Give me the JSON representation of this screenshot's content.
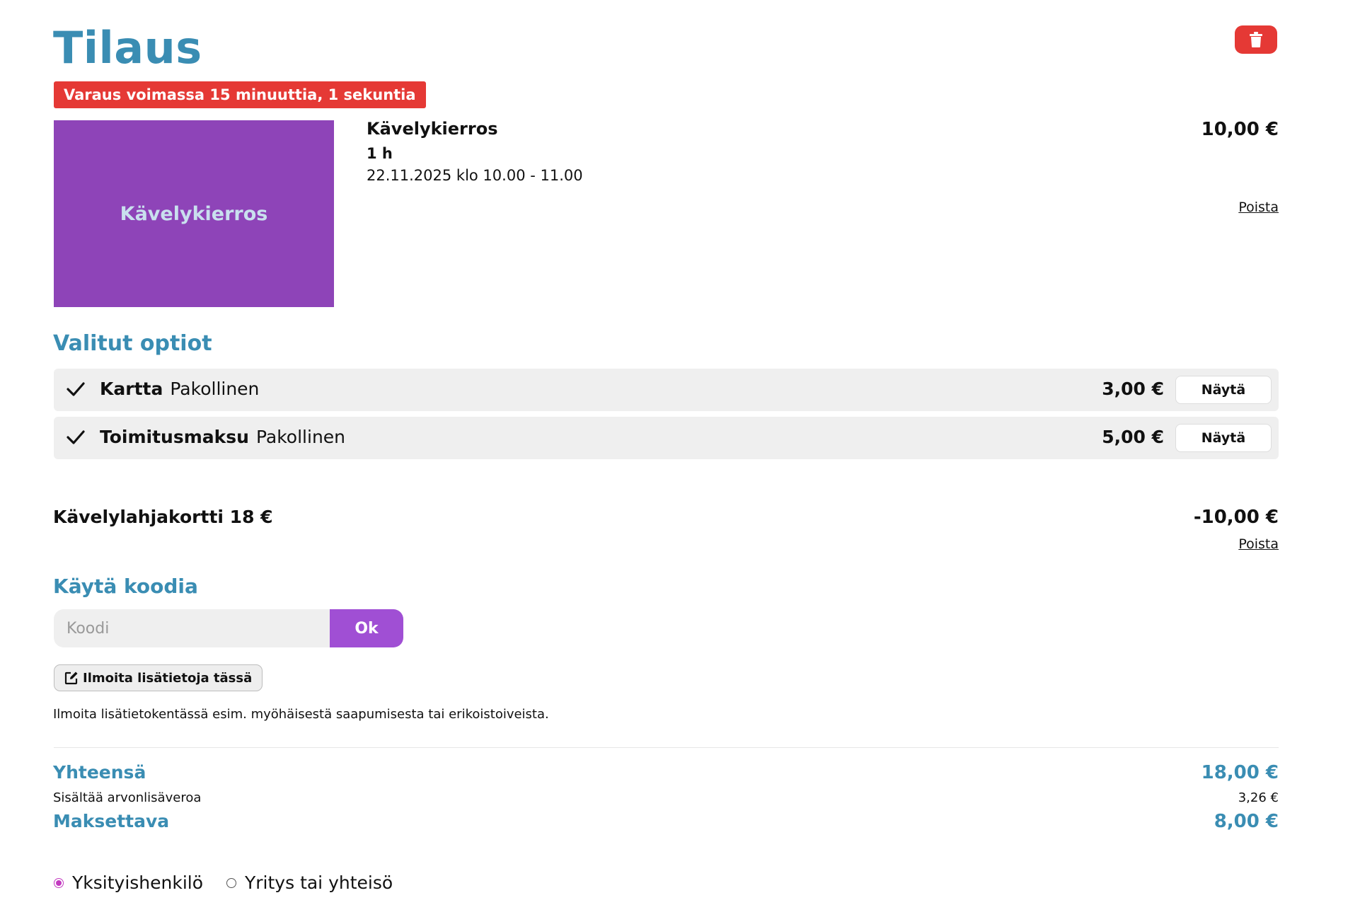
{
  "page": {
    "title": "Tilaus"
  },
  "reservation": {
    "timer_text": "Varaus voimassa 15 minuuttia, 1 sekuntia"
  },
  "product": {
    "image_label": "Kävelykierros",
    "name": "Kävelykierros",
    "duration": "1 h",
    "date": "22.11.2025 klo 10.00 - 11.00",
    "price": "10,00 €",
    "remove_label": "Poista"
  },
  "options": {
    "title": "Valitut optiot",
    "items": [
      {
        "name": "Kartta",
        "tag": "Pakollinen",
        "price": "3,00 €",
        "button": "Näytä"
      },
      {
        "name": "Toimitusmaksu",
        "tag": "Pakollinen",
        "price": "5,00 €",
        "button": "Näytä"
      }
    ]
  },
  "voucher": {
    "name": "Kävelylahjakortti 18 €",
    "amount": "-10,00 €",
    "remove_label": "Poista"
  },
  "code": {
    "title": "Käytä koodia",
    "placeholder": "Koodi",
    "button": "Ok"
  },
  "extra_info": {
    "button": "Ilmoita lisätietoja tässä",
    "help_text": "Ilmoita lisätietokentässä esim. myöhäisestä saapumisesta tai erikoistoiveista."
  },
  "totals": {
    "total_label": "Yhteensä",
    "total_value": "18,00 €",
    "vat_label": "Sisältää arvonlisäveroa",
    "vat_value": "3,26 €",
    "payable_label": "Maksettava",
    "payable_value": "8,00 €"
  },
  "customer_type": {
    "options": [
      "Yksityishenkilö",
      "Yritys tai yhteisö"
    ],
    "selected": "Yksityishenkilö"
  },
  "colors": {
    "accent": "#3a8db3",
    "danger": "#e53935",
    "purple": "#a04fd4",
    "image_bg": "#8e44b8"
  },
  "icons": {
    "delete": "trash-icon",
    "check": "check-icon",
    "edit": "edit-icon"
  }
}
